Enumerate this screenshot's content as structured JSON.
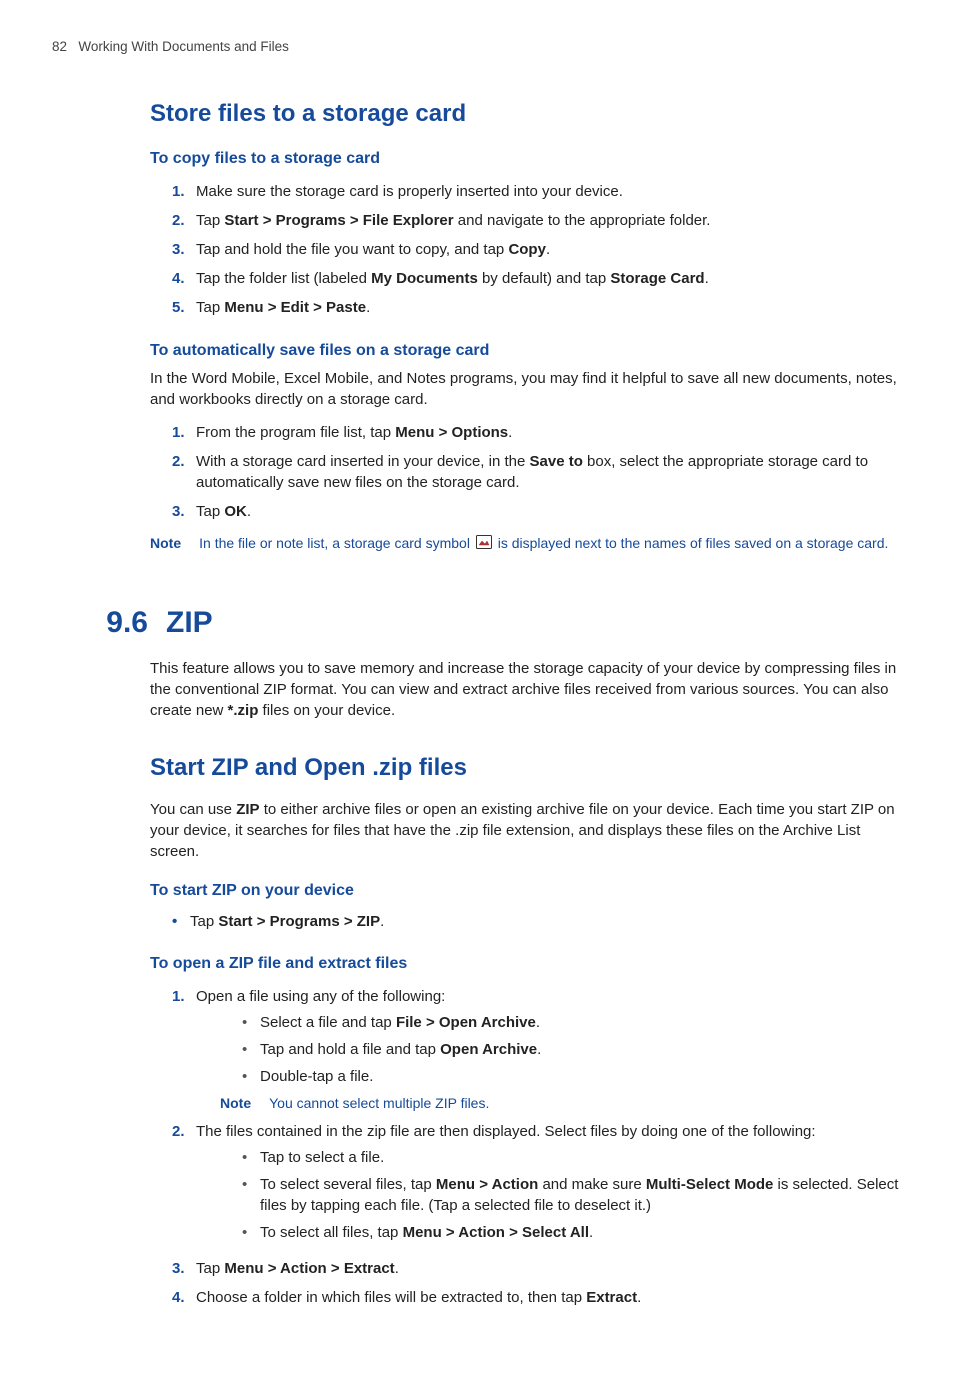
{
  "header": {
    "page_number": "82",
    "chapter_title": "Working With Documents and Files"
  },
  "section_store": {
    "title": "Store files to a storage card",
    "copy": {
      "heading": "To copy files to a storage card",
      "steps": [
        {
          "n": "1.",
          "pre": "Make sure the storage card is properly inserted into your device."
        },
        {
          "n": "2.",
          "pre": "Tap ",
          "b1": "Start > Programs > File Explorer",
          "mid": " and navigate to the appropriate folder."
        },
        {
          "n": "3.",
          "pre": "Tap and hold the file you want to copy, and tap ",
          "b1": "Copy",
          "post": "."
        },
        {
          "n": "4.",
          "pre": "Tap the folder list (labeled ",
          "b1": "My Documents",
          "mid": " by default) and tap ",
          "b2": "Storage Card",
          "post": "."
        },
        {
          "n": "5.",
          "pre": "Tap ",
          "b1": "Menu > Edit > Paste",
          "post": "."
        }
      ]
    },
    "auto": {
      "heading": "To automatically save files on a storage card",
      "intro": "In the Word Mobile, Excel Mobile, and Notes programs, you may find it helpful to save all new documents, notes, and workbooks directly on a storage card.",
      "steps": [
        {
          "n": "1.",
          "pre": "From the program file list, tap ",
          "b1": "Menu > Options",
          "post": "."
        },
        {
          "n": "2.",
          "pre": "With a storage card inserted in your device, in the ",
          "b1": "Save to",
          "mid": " box, select the appropriate storage card to automatically save new files on the storage card."
        },
        {
          "n": "3.",
          "pre": "Tap ",
          "b1": "OK",
          "post": "."
        }
      ],
      "note": {
        "label": "Note",
        "pre": "In the file or note list, a storage card symbol ",
        "post": " is displayed next to the names of files saved on a storage card."
      }
    }
  },
  "section_zip": {
    "number": "9.6",
    "title": "ZIP",
    "intro_pre": "This feature allows you to save memory and increase the storage capacity of your device by compressing files in the conventional ZIP format. You can view and extract archive files received from various sources. You can also create new ",
    "intro_b": "*.zip",
    "intro_post": " files on your device.",
    "start": {
      "title": "Start ZIP and Open .zip files",
      "intro_pre": "You can use ",
      "intro_b": "ZIP",
      "intro_post": " to either archive files or open an existing archive file on your device. Each time you start ZIP on your device, it searches for files that have the .zip file extension, and displays these files on the Archive List screen.",
      "start_heading": "To start ZIP on your device",
      "start_bullet_pre": "Tap ",
      "start_bullet_b": "Start > Programs > ZIP",
      "start_bullet_post": ".",
      "open_heading": "To open a ZIP file and extract files",
      "step1": {
        "n": "1.",
        "text": "Open a file using any of the following:"
      },
      "step1_items": [
        {
          "pre": "Select a file and tap ",
          "b1": "File > Open Archive",
          "post": "."
        },
        {
          "pre": "Tap and hold a file and tap ",
          "b1": "Open Archive",
          "post": "."
        },
        {
          "pre": "Double-tap a file."
        }
      ],
      "step1_note": {
        "label": "Note",
        "text": "You cannot select multiple ZIP files."
      },
      "step2": {
        "n": "2.",
        "text": "The files contained in the zip file are then displayed. Select files by doing one of the following:"
      },
      "step2_items": [
        {
          "pre": "Tap to select a file."
        },
        {
          "pre": "To select several files, tap ",
          "b1": "Menu > Action",
          "mid": " and make sure ",
          "b2": "Multi-Select Mode",
          "post": " is selected. Select files by tapping each file. (Tap a selected file to deselect it.)"
        },
        {
          "pre": "To select all files, tap ",
          "b1": "Menu > Action > Select All",
          "post": "."
        }
      ],
      "step3": {
        "n": "3.",
        "pre": "Tap ",
        "b1": "Menu > Action > Extract",
        "post": "."
      },
      "step4": {
        "n": "4.",
        "pre": "Choose a folder in which files will be extracted to, then tap ",
        "b1": "Extract",
        "post": "."
      }
    }
  }
}
